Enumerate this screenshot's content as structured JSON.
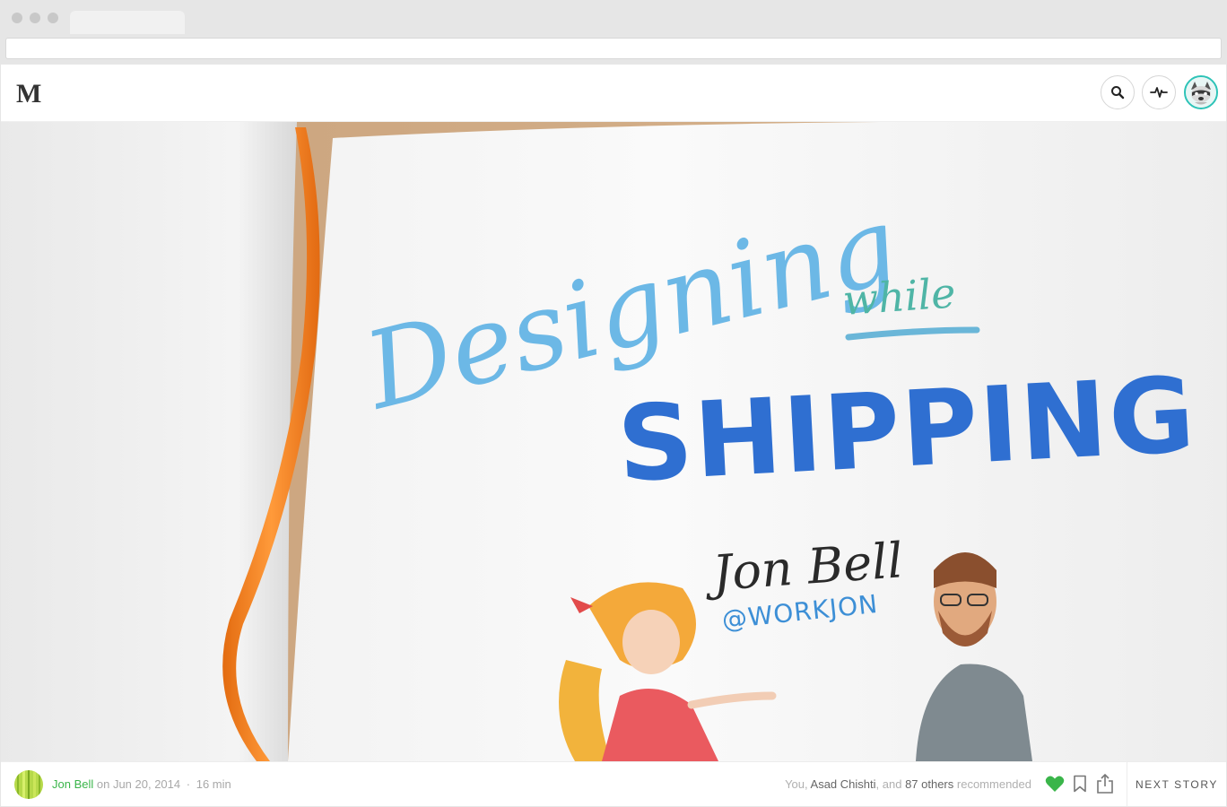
{
  "brand": {
    "logo_text": "M"
  },
  "header": {
    "search_icon": "search-icon",
    "activity_icon": "activity-pulse-icon"
  },
  "hero": {
    "title_word_1": "Designing",
    "title_word_2": "while",
    "title_word_3": "SHIPPING",
    "author_script": "Jon Bell",
    "handle": "@WORKJON"
  },
  "footer": {
    "author_name": "Jon Bell",
    "date_text": "on Jun 20, 2014",
    "separator": "·",
    "read_time": "16 min",
    "recommended": {
      "you": "You,",
      "person": "Asad Chishti",
      "and": ", and",
      "count": "87 others",
      "suffix": "recommended"
    },
    "next_story_label": "NEXT STORY"
  },
  "colors": {
    "accent_green": "#3ab54a",
    "avatar_ring": "#2dc3b7",
    "ribbon_orange": "#f07a1a",
    "title_blue": "#2f6fd1"
  }
}
